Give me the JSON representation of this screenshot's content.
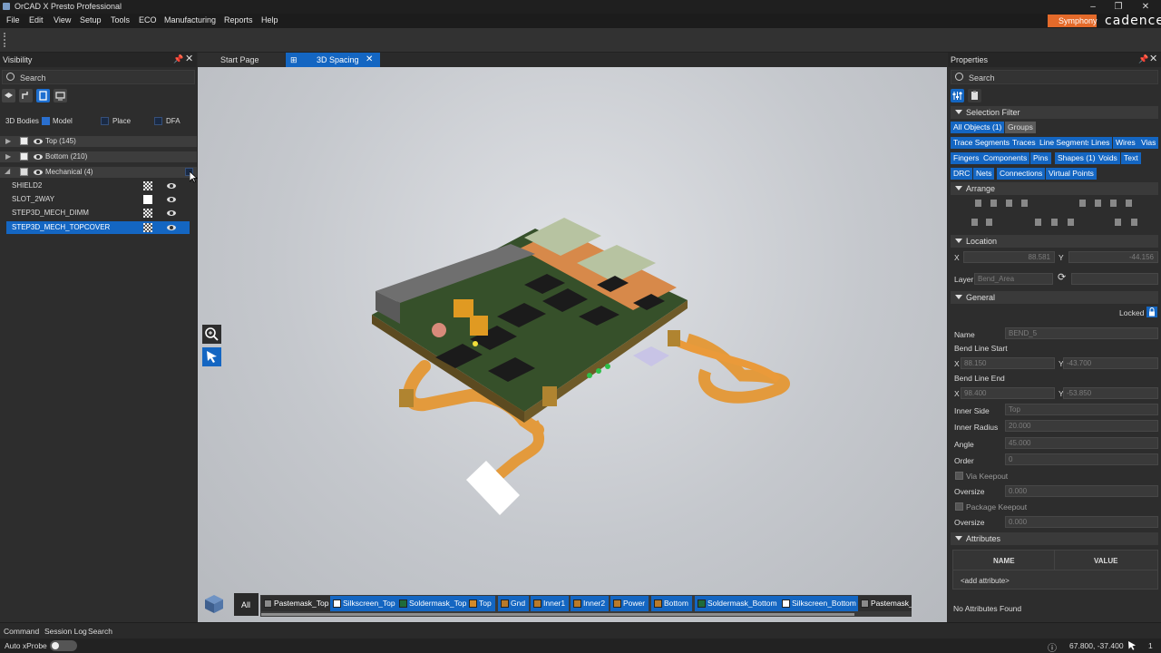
{
  "window": {
    "title": "OrCAD X Presto Professional"
  },
  "menu": [
    "File",
    "Edit",
    "View",
    "Setup",
    "Tools",
    "ECO",
    "Manufacturing",
    "Reports",
    "Help"
  ],
  "brand": {
    "symphony": "Symphony",
    "cadence": "cadence"
  },
  "visibility": {
    "title": "Visibility",
    "search_placeholder": "Search",
    "bodies_label": "3D Bodies",
    "model_label": "Model",
    "place_label": "Place",
    "dfa_label": "DFA",
    "groups": [
      {
        "label": "Top (145)"
      },
      {
        "label": "Bottom (210)"
      },
      {
        "label": "Mechanical (4)"
      }
    ],
    "children": [
      "SHIELD2",
      "SLOT_2WAY",
      "STEP3D_MECH_DIMM",
      "STEP3D_MECH_TOPCOVER"
    ]
  },
  "tabs": [
    {
      "label": "Start Page"
    },
    {
      "label": "3D Spacing"
    }
  ],
  "layerbar": {
    "all_label": "All",
    "layers": [
      {
        "label": "Pastemask_Top",
        "color": "#8a8a8a"
      },
      {
        "label": "Silkscreen_Top",
        "color": "#ffffff"
      },
      {
        "label": "Soldermask_Top",
        "color": "#1f6b3a"
      },
      {
        "label": "Top",
        "color": "#d28a2a"
      },
      {
        "label": "Gnd",
        "color": "#b87a2a"
      },
      {
        "label": "Inner1",
        "color": "#b87a2a"
      },
      {
        "label": "Inner2",
        "color": "#b87a2a"
      },
      {
        "label": "Power",
        "color": "#b87a2a"
      },
      {
        "label": "Bottom",
        "color": "#b87a2a"
      },
      {
        "label": "Soldermask_Bottom",
        "color": "#1f6b3a"
      },
      {
        "label": "Silkscreen_Bottom",
        "color": "#ffffff"
      },
      {
        "label": "Pastemask_",
        "color": "#8a8a8a"
      }
    ]
  },
  "properties": {
    "title": "Properties",
    "search_placeholder": "Search",
    "selection_filter_title": "Selection Filter",
    "filters": [
      "All Objects (1)",
      "Groups",
      "Trace Segments",
      "Traces",
      "Line Segments",
      "Lines",
      "Wires",
      "Vias",
      "Fingers",
      "Components",
      "Pins",
      "Shapes (1)",
      "Voids",
      "Text",
      "DRC",
      "Nets",
      "Connections",
      "Virtual Points"
    ],
    "arrange_title": "Arrange",
    "location_title": "Location",
    "x_label": "X",
    "x_value": "88.581",
    "y_label": "Y",
    "y_value": "-44.156",
    "layer_label": "Layer",
    "layer_value": "Bend_Area",
    "general_title": "General",
    "locked_label": "Locked",
    "name_label": "Name",
    "name_value": "BEND_5",
    "bend_start_label": "Bend Line Start",
    "bend_start_x": "88.150",
    "bend_start_y": "-43.700",
    "bend_end_label": "Bend Line End",
    "bend_end_x": "98.400",
    "bend_end_y": "-53.850",
    "inner_side_label": "Inner Side",
    "inner_side_value": "Top",
    "inner_radius_label": "Inner Radius",
    "inner_radius_value": "20.000",
    "angle_label": "Angle",
    "angle_value": "45.000",
    "order_label": "Order",
    "order_value": "0",
    "via_keepout_label": "Via Keepout",
    "oversize_label": "Oversize",
    "oversize_value": "0.000",
    "package_keepout_label": "Package Keepout",
    "oversize2_value": "0.000",
    "attributes_title": "Attributes",
    "attr_name_col": "NAME",
    "attr_value_col": "VALUE",
    "add_attribute": "<add attribute>",
    "no_attributes": "No Attributes Found"
  },
  "bottom_tabs": [
    "Command",
    "Session Log",
    "Search"
  ],
  "status": {
    "auto_xprobe": "Auto xProbe",
    "coords": "67.800, -37.400",
    "count": "1"
  }
}
